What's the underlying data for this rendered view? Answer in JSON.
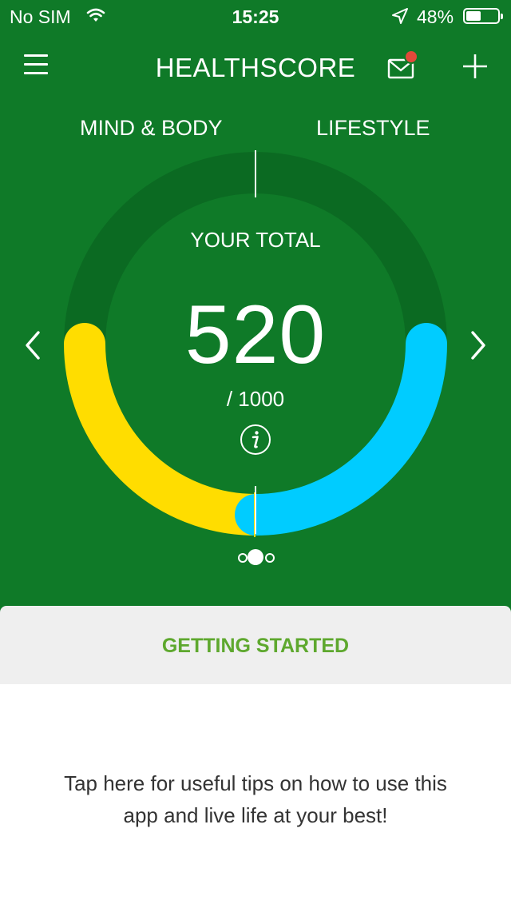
{
  "status_bar": {
    "carrier": "No SIM",
    "time": "15:25",
    "battery_percent": "48%",
    "battery_level": 0.48,
    "icons": [
      "wifi-icon",
      "location-arrow-icon",
      "battery-icon"
    ]
  },
  "nav": {
    "title": "HEALTHSCORE",
    "icons": [
      "menu-icon",
      "mail-icon",
      "plus-icon"
    ],
    "has_unread_mail": true
  },
  "tabs": [
    {
      "label": "MIND & BODY"
    },
    {
      "label": "LIFESTYLE"
    }
  ],
  "score": {
    "heading": "YOUR TOTAL",
    "value": "520",
    "max": "/ 1000",
    "mind_body_fraction": 0.5,
    "lifestyle_fraction": 0.5
  },
  "pager": {
    "count": 3,
    "active_index": 1
  },
  "card": {
    "heading": "GETTING STARTED",
    "text": "Tap here for useful tips on how to use this app and live life at your best!"
  },
  "colors": {
    "background": "#0f7a28",
    "ring_track": "#0b6a22",
    "mind_body": "#ffdd00",
    "lifestyle": "#00ccff",
    "card_heading": "#5ea82e",
    "notification": "#e1493a"
  }
}
